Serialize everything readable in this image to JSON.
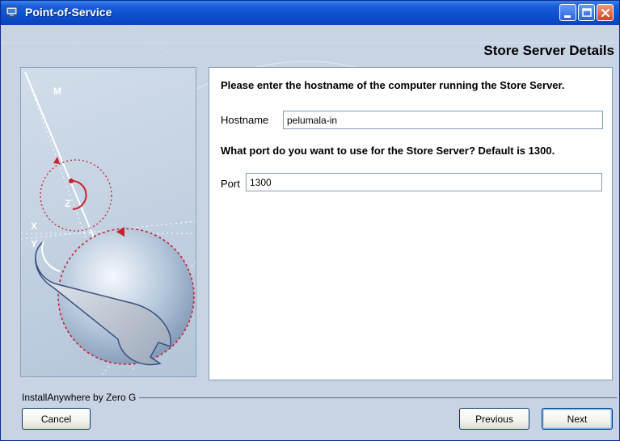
{
  "window": {
    "title": "Point-of-Service",
    "icon": "installer-icon",
    "controls": [
      "minimize-icon",
      "maximize-icon",
      "close-icon"
    ]
  },
  "page_title": "Store Server Details",
  "form": {
    "hostname_question": "Please enter the hostname of the computer running the Store Server.",
    "hostname_label": "Hostname",
    "hostname_value": "pelumala-in",
    "port_question": "What port do you want to use for the Store Server? Default is 1300.",
    "port_label": "Port",
    "port_value": "1300"
  },
  "graphic": {
    "axis_labels": {
      "m": "M",
      "z": "Z",
      "x": "X",
      "y": "Y"
    },
    "icon": "wrench-icon"
  },
  "footer": {
    "vendor": "InstallAnywhere by Zero G",
    "cancel_label": "Cancel",
    "previous_label": "Previous",
    "next_label": "Next"
  },
  "colors": {
    "titlebar": "#0b4fd0",
    "background": "#c8d4e4",
    "accent_red": "#cc1f2a"
  }
}
